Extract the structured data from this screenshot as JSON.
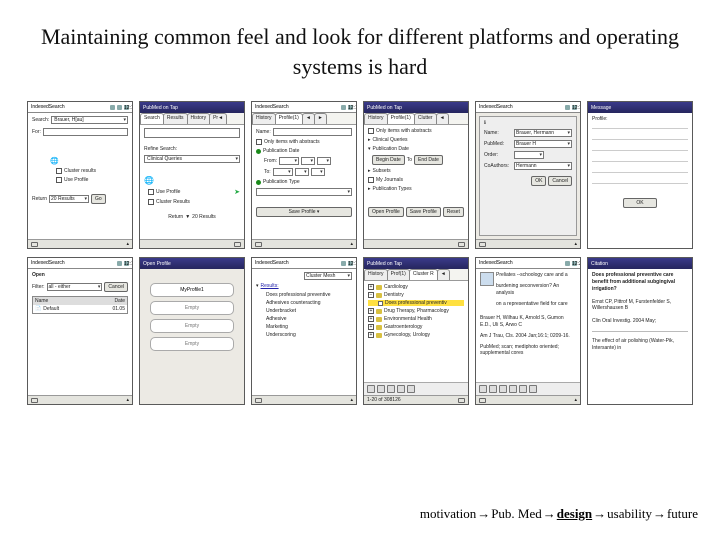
{
  "title": "Maintaining common feel and look for different platforms and operating systems is hard",
  "breadcrumb": {
    "items": [
      "motivation",
      "Pub. Med",
      "design",
      "usability",
      "future"
    ],
    "active_index": 2
  },
  "screens": [
    {
      "id": "a1",
      "platform": "palm-light",
      "header": {
        "left": "IndexedSearch",
        "right": "12:12"
      },
      "body": {
        "search_label": "Search:",
        "search_field_value": "Brauer, H[au]",
        "for_label": "For:",
        "cluster_label": "Cluster results",
        "useprofile_label": "Use Profile",
        "return_label": "Return",
        "return_value": "20 Results",
        "go_label": "Go"
      }
    },
    {
      "id": "a2",
      "platform": "ppc",
      "header": {
        "left": "PubMed on Tap",
        "right": ""
      },
      "tabs": [
        "Search",
        "Results",
        "History",
        "Pr◄",
        "►"
      ],
      "body": {
        "search_placeholder": "",
        "refine_label": "Refine Search:",
        "refine_value": "Clinical Queries",
        "useprofile_label": "Use Profile",
        "cluster_label": "Cluster Results",
        "return_label": "Return",
        "return_value": "20 Results",
        "arrow_icon": "right-arrow"
      }
    },
    {
      "id": "a3",
      "platform": "palm-light",
      "header": {
        "left": "IndexedSearch",
        "right": "12:12"
      },
      "tabs": [
        "History",
        "Profile(1)",
        "◄",
        "►"
      ],
      "body": {
        "name_label": "Name:",
        "abstracts_label": "Only items with abstracts",
        "pubdate_label": "Publication Date",
        "from_label": "From:",
        "to_label": "To:",
        "pubtype_label": "Publication Type",
        "saveprofile_btn": "Save Profile ▾"
      }
    },
    {
      "id": "a4",
      "platform": "ppc",
      "header": {
        "left": "PubMed on Tap",
        "right": ""
      },
      "tabs": [
        "History",
        "Profile(1)",
        "Clutter",
        "◄",
        "►"
      ],
      "body": {
        "abstracts_label": "Only items with abstracts",
        "clinicalq_label": "Clinical Queries",
        "pubdate_label": "Publication Date",
        "begin_btn": "Begin Date",
        "to_label": "To",
        "end_btn": "End Date",
        "subsets_label": "Subsets",
        "myjournals_label": "My Journals",
        "pubtypes_label": "Publication Types",
        "open_btn": "Open Profile",
        "save_btn": "Save Profile",
        "reset_btn": "Reset"
      }
    },
    {
      "id": "a5",
      "platform": "palm-light",
      "header": {
        "left": "IndexedSearch",
        "right": "12:16"
      },
      "body": {
        "name_label": "Name:",
        "name_value": "Brauer, Hermann",
        "pubmed_label": "PubMed:",
        "pubmed_value": "Brauer H",
        "order_label": "Order:",
        "coauthors_label": "CoAuthors:",
        "coauthors_value": "Hermann",
        "ok_btn": "OK",
        "cancel_btn": "Cancel"
      }
    },
    {
      "id": "a6",
      "platform": "ppc",
      "header": {
        "left": "Message",
        "right": ""
      },
      "body": {
        "profile_label": "Profile:",
        "ok_btn": "OK"
      }
    },
    {
      "id": "b1",
      "platform": "palm-light",
      "header": {
        "left": "IndexedSearch",
        "right": "12:17"
      },
      "body": {
        "open_label": "Open",
        "filter_label": "Filter:",
        "filter_value": "all - either",
        "cancel_btn": "Cancel",
        "col_name": "Name",
        "col_date": "Date",
        "row1_name": "Default",
        "row1_date": "01.05"
      }
    },
    {
      "id": "b2",
      "platform": "ppc",
      "header": {
        "left": "Open Profile",
        "right": ""
      },
      "body": {
        "slot1": "MyProfile1",
        "empty": "Empty"
      }
    },
    {
      "id": "b3",
      "platform": "palm-light",
      "header": {
        "left": "IndexedSearch",
        "right": "12:17"
      },
      "body": {
        "cluster_label": "Cluster Mesh",
        "results_label": "Results:",
        "items": [
          "Does professional preventive",
          "Adhesives counteracting",
          "Underbracket",
          "Adhesive",
          "Marketing",
          "Underscoring"
        ]
      }
    },
    {
      "id": "b4",
      "platform": "ppc",
      "header": {
        "left": "PubMed on Tap",
        "right": ""
      },
      "tabs": [
        "History",
        "Prof(1)",
        "Cluster R",
        "◄",
        "►"
      ],
      "body": {
        "tree": [
          {
            "label": "Cardiology",
            "hi": false
          },
          {
            "label": "Dentistry",
            "hi": false
          },
          {
            "label": "Does professional preventiv",
            "hi": true
          },
          {
            "label": "Drug Therapy, Pharmacology",
            "hi": false
          },
          {
            "label": "Environmental Health",
            "hi": false
          },
          {
            "label": "Gastroenterology",
            "hi": false
          },
          {
            "label": "Gynecology, Urology",
            "hi": false
          }
        ],
        "footer": "1-20 of 308126"
      }
    },
    {
      "id": "b5",
      "platform": "palm-light",
      "header": {
        "left": "IndexedSearch",
        "right": "12:20"
      },
      "body": {
        "abstract_line1": "Preliates --schoology care and a",
        "abstract_line2": "burdening seconversion? An analysis",
        "abstract_line3": "on a representative field for care",
        "authors": "Brauer H, Wilhau K, Arnold S, Gumon E.D., Uli S, Arwo C",
        "journal": "Am J Trau, Cls. 2004 Jan;16:1; 0209-16.",
        "note": "PubMed; scan; mediphoto oriented; supplemental cores"
      }
    },
    {
      "id": "b6",
      "platform": "ppc",
      "header": {
        "left": "Citation",
        "right": ""
      },
      "body": {
        "question": "Does professional preventive care benefit from additional subgingival irrigation?",
        "authors": "Ernst CP, Pittrof M, Furstenfelder S, Willershausen B",
        "journal": "Clin Oral Investig. 2004 May;",
        "title2": "The effect of air polishing (Water-Pik, Intersante) in"
      }
    }
  ]
}
